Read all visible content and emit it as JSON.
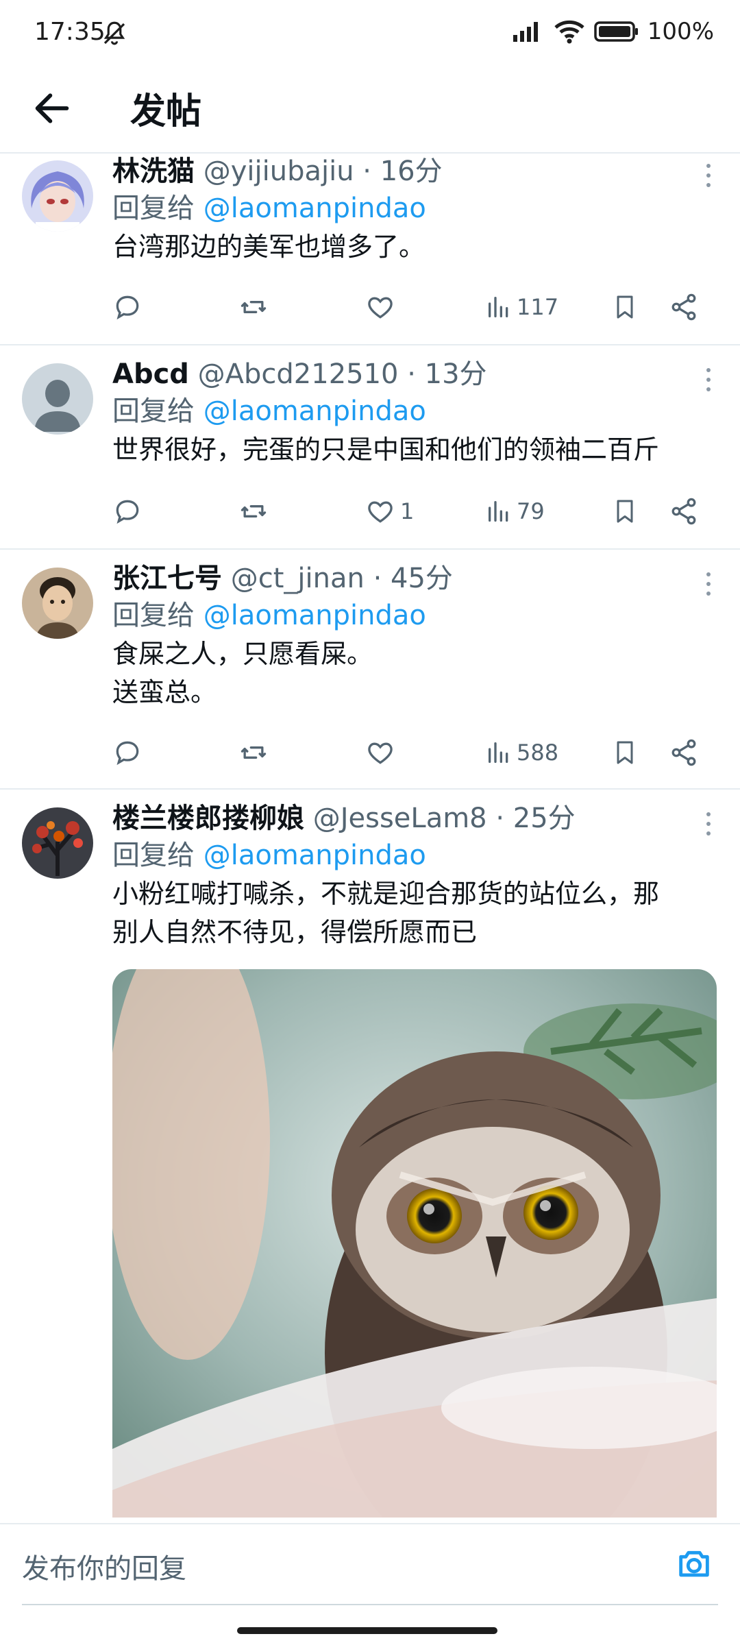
{
  "status_bar": {
    "time": "17:35",
    "battery": "100%",
    "icons": [
      "mute-bell-icon",
      "signal-icon",
      "wifi-icon",
      "battery-icon"
    ]
  },
  "header": {
    "title": "发帖",
    "back_icon": "arrow-left-icon"
  },
  "colors": {
    "link": "#1d9bf0",
    "secondary_text": "#536471",
    "primary_text": "#0f1419",
    "divider": "#e6ecf0"
  },
  "tweets": [
    {
      "name": "林洗猫",
      "handle": "@yijiubajiu",
      "dot": "·",
      "time": "16分",
      "reply_prefix": "回复给",
      "reply_to": "@laomanpindao",
      "text": "台湾那边的美军也增多了。",
      "likes": "",
      "views": "117"
    },
    {
      "name": "Abcd",
      "handle": "@Abcd212510",
      "dot": "·",
      "time": "13分",
      "reply_prefix": "回复给",
      "reply_to": "@laomanpindao",
      "text": "世界很好，完蛋的只是中国和他们的领袖二百斤",
      "likes": "1",
      "views": "79"
    },
    {
      "name": "张江七号",
      "handle": "@ct_jinan",
      "dot": "·",
      "time": "45分",
      "reply_prefix": "回复给",
      "reply_to": "@laomanpindao",
      "text": "食屎之人，只愿看屎。\n送蛮总。",
      "likes": "",
      "views": "588"
    },
    {
      "name": "楼兰楼郎搂柳娘",
      "handle": "@JesseLam8",
      "dot": "·",
      "time": "25分",
      "reply_prefix": "回复给",
      "reply_to": "@laomanpindao",
      "text": "小粉红喊打喊杀，不就是迎合那货的站位么，那\n别人自然不待见，得偿所愿而已",
      "likes": "",
      "views": ""
    }
  ],
  "compose": {
    "placeholder": "发布你的回复",
    "camera_icon": "camera-icon"
  }
}
